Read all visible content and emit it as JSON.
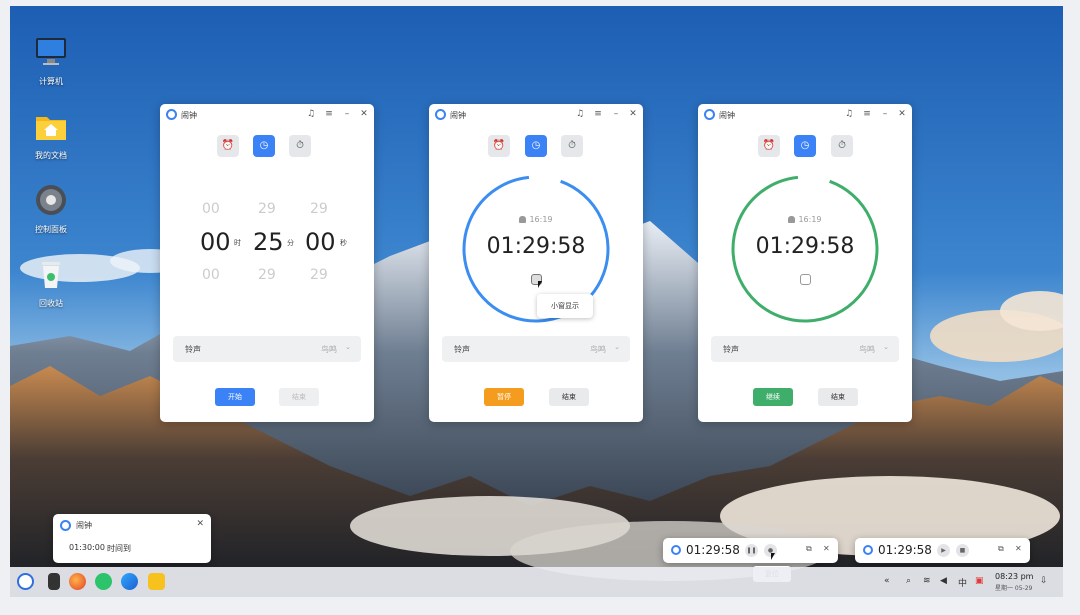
{
  "desktop": {
    "icons": [
      {
        "label": "计算机"
      },
      {
        "label": "我的文档"
      },
      {
        "label": "控制面板"
      },
      {
        "label": "回收站"
      }
    ]
  },
  "app": {
    "title": "闹钟"
  },
  "window1": {
    "picker": {
      "hours_prev": "00",
      "hours": "00",
      "hours_next": "00",
      "minutes_prev": "29",
      "minutes": "25",
      "minutes_next": "29",
      "seconds_prev": "29",
      "seconds": "00",
      "seconds_next": "29",
      "unit_h": "时",
      "unit_m": "分",
      "unit_s": "秒"
    },
    "ringtone_label": "铃声",
    "ringtone_value": "鸟鸣",
    "start": "开始",
    "end": "结束"
  },
  "window2": {
    "alarm_time": "16:19",
    "countdown": "01:29:58",
    "tooltip": "小窗显示",
    "ringtone_label": "铃声",
    "ringtone_value": "鸟鸣",
    "pause": "暂停",
    "end": "结束",
    "ring_color": "#3b8ef0"
  },
  "window3": {
    "alarm_time": "16:19",
    "countdown": "01:29:58",
    "ringtone_label": "铃声",
    "ringtone_value": "鸟鸣",
    "continue": "继续",
    "end": "结束",
    "ring_color": "#3fae6a"
  },
  "notification": {
    "title": "闹钟",
    "time": "01:30:00",
    "message": "时间到"
  },
  "mini_timer_1": {
    "time": "01:29:58",
    "tooltip": "复位"
  },
  "mini_timer_2": {
    "time": "01:29:58"
  },
  "taskbar": {
    "ime": "中",
    "time": "08:23 pm",
    "date": "星期一 05-29"
  },
  "colors": {
    "accent": "#3b82f6",
    "pause": "#f39c1e",
    "continue": "#3fae6a"
  }
}
